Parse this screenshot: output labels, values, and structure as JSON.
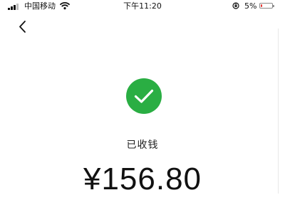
{
  "status_bar": {
    "carrier": "中国移动",
    "time": "下午11:20",
    "battery_percent": "5%",
    "battery_level": 0.05,
    "battery_color": "#e53935",
    "icons": [
      "signal-icon",
      "wifi-icon",
      "orientation-lock-icon",
      "battery-icon"
    ]
  },
  "nav": {
    "back_icon": "chevron-left-icon"
  },
  "payment": {
    "icon": "checkmark-circle-icon",
    "icon_color": "#2aae43",
    "status_text": "已收钱",
    "amount": "¥156.80"
  }
}
